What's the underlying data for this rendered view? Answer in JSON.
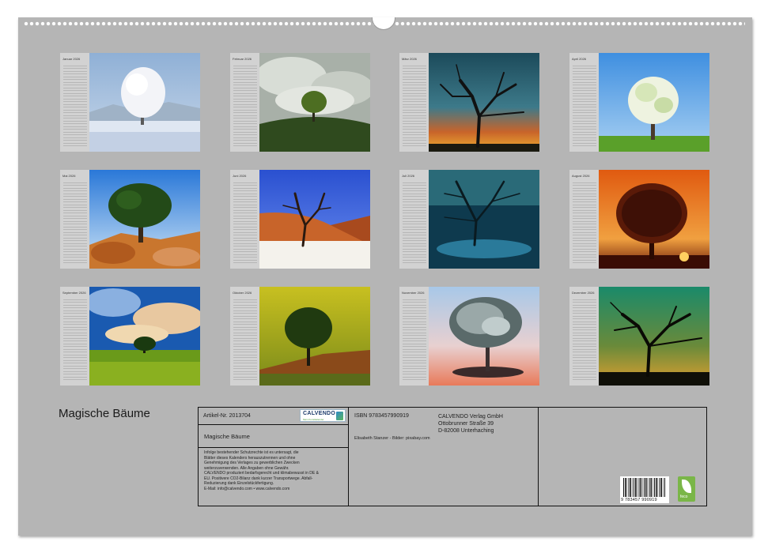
{
  "calendar": {
    "title": "Magische Bäume"
  },
  "months": [
    {
      "name": "Januar 2026",
      "icon": "snowy-tree-photo"
    },
    {
      "name": "Februar 2026",
      "icon": "tree-on-hill-clouds-photo"
    },
    {
      "name": "März 2026",
      "icon": "bare-tree-sunset-photo"
    },
    {
      "name": "April 2026",
      "icon": "blossom-tree-photo"
    },
    {
      "name": "Mai 2026",
      "icon": "tree-on-rocks-photo"
    },
    {
      "name": "Juni 2026",
      "icon": "dead-tree-desert-photo"
    },
    {
      "name": "Juli 2026",
      "icon": "tree-in-water-photo"
    },
    {
      "name": "August 2026",
      "icon": "tree-orange-sunset-photo"
    },
    {
      "name": "September 2026",
      "icon": "tree-dramatic-sky-photo"
    },
    {
      "name": "Oktober 2026",
      "icon": "tree-yellow-sky-photo"
    },
    {
      "name": "November 2026",
      "icon": "frosted-tree-photo"
    },
    {
      "name": "Dezember 2026",
      "icon": "silhouette-tree-photo"
    }
  ],
  "info": {
    "artikel": "Artikel-Nr. 2013704",
    "logo_brand": "CALVENDO",
    "logo_tag": "Mein Kunstkalender",
    "title": "Magische Bäume",
    "disclaimer": "Infolge bestehender Schutzrechte ist es untersagt, die\nBlätter dieses Kalenders herauszutrennen und ohne\nGenehmigung des Verlages zu gewerblichen Zwecken\nweiterzuverwenden. Alle Angaben ohne Gewähr.\nCALVENDO produziert bedarfsgerecht und klimabewusst in DE &\nEU. Positivere CO2-Bilanz dank kurzer Transportwege. Abfall-\nReduzierung dank Einzelstückfertigung.\nE-Mail: info@calvendo.com • www.calvendo.com",
    "isbn": "ISBN 9783457990919",
    "publisher": "CALVENDO Verlag GmbH\nOttobrunner Straße 39\nD-82008 Unterhaching",
    "credits": "Elisabeth Stanzer - Bilder: pixabay.com",
    "barcode_number": "9 783457 990919",
    "eco_label": "feco"
  },
  "colors": {
    "sheet": "#b5b5b5",
    "grid_panel": "#d2d2d2",
    "eco_green": "#7ab648"
  }
}
